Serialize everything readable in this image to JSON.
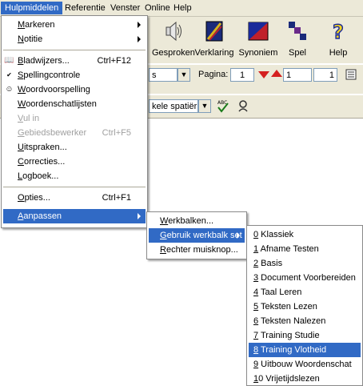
{
  "menubar": {
    "items": [
      "Hulpmiddelen",
      "Referentie",
      "Venster",
      "Online",
      "Help"
    ]
  },
  "toolbar": {
    "buttons": [
      "Gesproken",
      "Verklaring",
      "Synoniem",
      "Spel",
      "Help"
    ],
    "pagina_label": "Pagina:",
    "pagina_value": "1",
    "page_field_value": "1",
    "page_total": "1",
    "style_field": "s",
    "spacing_value": "kele spatiëring",
    "icons": [
      "speaker-icon",
      "explanation-icon",
      "synonym-icon",
      "game-icon",
      "help-icon"
    ]
  },
  "main_menu": {
    "items": [
      {
        "label": "Markeren",
        "shortcut": "",
        "submenu": true
      },
      {
        "label": "Notitie",
        "shortcut": "",
        "submenu": true
      },
      {
        "label": "Bladwijzers...",
        "shortcut": "Ctrl+F12"
      },
      {
        "label": "Spellingcontrole",
        "shortcut": ""
      },
      {
        "label": "Woordvoorspelling",
        "shortcut": ""
      },
      {
        "label": "Woordenschatlijsten",
        "shortcut": ""
      },
      {
        "label": "Vul in",
        "shortcut": "",
        "disabled": true
      },
      {
        "label": "Gebiedsbewerker",
        "shortcut": "Ctrl+F5",
        "disabled": true
      },
      {
        "label": "Uitspraken...",
        "shortcut": ""
      },
      {
        "label": "Correcties...",
        "shortcut": ""
      },
      {
        "label": "Logboek...",
        "shortcut": ""
      },
      {
        "label": "Opties...",
        "shortcut": "Ctrl+F1"
      },
      {
        "label": "Aanpassen",
        "shortcut": "",
        "submenu": true
      }
    ]
  },
  "aanpassen_menu": {
    "items": [
      "Werkbalken...",
      "Gebruik werkbalk set",
      "Rechter muisknop..."
    ]
  },
  "werkbalk_set_menu": {
    "items": [
      "0 Klassiek",
      "1 Afname Testen",
      "2 Basis",
      "3 Document Voorbereiden",
      "4 Taal Leren",
      "5 Teksten Lezen",
      "6 Teksten Nalezen",
      "7 Training Studie",
      "8 Training Vlotheid",
      "9 Uitbouw Woordenschat",
      "10 Vrijetijdslezen"
    ],
    "highlighted": "8 Training Vlotheid"
  },
  "colors": {
    "highlight": "#316ac5",
    "chrome": "#ece9d8"
  }
}
